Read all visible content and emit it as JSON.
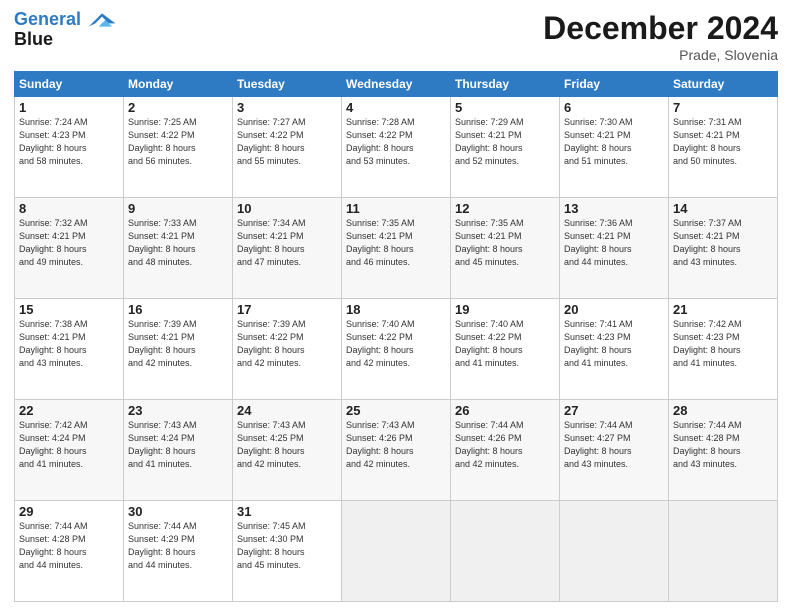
{
  "header": {
    "logo_line1": "General",
    "logo_line2": "Blue",
    "month": "December 2024",
    "location": "Prade, Slovenia"
  },
  "weekdays": [
    "Sunday",
    "Monday",
    "Tuesday",
    "Wednesday",
    "Thursday",
    "Friday",
    "Saturday"
  ],
  "weeks": [
    [
      {
        "day": "1",
        "info": "Sunrise: 7:24 AM\nSunset: 4:23 PM\nDaylight: 8 hours\nand 58 minutes."
      },
      {
        "day": "2",
        "info": "Sunrise: 7:25 AM\nSunset: 4:22 PM\nDaylight: 8 hours\nand 56 minutes."
      },
      {
        "day": "3",
        "info": "Sunrise: 7:27 AM\nSunset: 4:22 PM\nDaylight: 8 hours\nand 55 minutes."
      },
      {
        "day": "4",
        "info": "Sunrise: 7:28 AM\nSunset: 4:22 PM\nDaylight: 8 hours\nand 53 minutes."
      },
      {
        "day": "5",
        "info": "Sunrise: 7:29 AM\nSunset: 4:21 PM\nDaylight: 8 hours\nand 52 minutes."
      },
      {
        "day": "6",
        "info": "Sunrise: 7:30 AM\nSunset: 4:21 PM\nDaylight: 8 hours\nand 51 minutes."
      },
      {
        "day": "7",
        "info": "Sunrise: 7:31 AM\nSunset: 4:21 PM\nDaylight: 8 hours\nand 50 minutes."
      }
    ],
    [
      {
        "day": "8",
        "info": "Sunrise: 7:32 AM\nSunset: 4:21 PM\nDaylight: 8 hours\nand 49 minutes."
      },
      {
        "day": "9",
        "info": "Sunrise: 7:33 AM\nSunset: 4:21 PM\nDaylight: 8 hours\nand 48 minutes."
      },
      {
        "day": "10",
        "info": "Sunrise: 7:34 AM\nSunset: 4:21 PM\nDaylight: 8 hours\nand 47 minutes."
      },
      {
        "day": "11",
        "info": "Sunrise: 7:35 AM\nSunset: 4:21 PM\nDaylight: 8 hours\nand 46 minutes."
      },
      {
        "day": "12",
        "info": "Sunrise: 7:35 AM\nSunset: 4:21 PM\nDaylight: 8 hours\nand 45 minutes."
      },
      {
        "day": "13",
        "info": "Sunrise: 7:36 AM\nSunset: 4:21 PM\nDaylight: 8 hours\nand 44 minutes."
      },
      {
        "day": "14",
        "info": "Sunrise: 7:37 AM\nSunset: 4:21 PM\nDaylight: 8 hours\nand 43 minutes."
      }
    ],
    [
      {
        "day": "15",
        "info": "Sunrise: 7:38 AM\nSunset: 4:21 PM\nDaylight: 8 hours\nand 43 minutes."
      },
      {
        "day": "16",
        "info": "Sunrise: 7:39 AM\nSunset: 4:21 PM\nDaylight: 8 hours\nand 42 minutes."
      },
      {
        "day": "17",
        "info": "Sunrise: 7:39 AM\nSunset: 4:22 PM\nDaylight: 8 hours\nand 42 minutes."
      },
      {
        "day": "18",
        "info": "Sunrise: 7:40 AM\nSunset: 4:22 PM\nDaylight: 8 hours\nand 42 minutes."
      },
      {
        "day": "19",
        "info": "Sunrise: 7:40 AM\nSunset: 4:22 PM\nDaylight: 8 hours\nand 41 minutes."
      },
      {
        "day": "20",
        "info": "Sunrise: 7:41 AM\nSunset: 4:23 PM\nDaylight: 8 hours\nand 41 minutes."
      },
      {
        "day": "21",
        "info": "Sunrise: 7:42 AM\nSunset: 4:23 PM\nDaylight: 8 hours\nand 41 minutes."
      }
    ],
    [
      {
        "day": "22",
        "info": "Sunrise: 7:42 AM\nSunset: 4:24 PM\nDaylight: 8 hours\nand 41 minutes."
      },
      {
        "day": "23",
        "info": "Sunrise: 7:43 AM\nSunset: 4:24 PM\nDaylight: 8 hours\nand 41 minutes."
      },
      {
        "day": "24",
        "info": "Sunrise: 7:43 AM\nSunset: 4:25 PM\nDaylight: 8 hours\nand 42 minutes."
      },
      {
        "day": "25",
        "info": "Sunrise: 7:43 AM\nSunset: 4:26 PM\nDaylight: 8 hours\nand 42 minutes."
      },
      {
        "day": "26",
        "info": "Sunrise: 7:44 AM\nSunset: 4:26 PM\nDaylight: 8 hours\nand 42 minutes."
      },
      {
        "day": "27",
        "info": "Sunrise: 7:44 AM\nSunset: 4:27 PM\nDaylight: 8 hours\nand 43 minutes."
      },
      {
        "day": "28",
        "info": "Sunrise: 7:44 AM\nSunset: 4:28 PM\nDaylight: 8 hours\nand 43 minutes."
      }
    ],
    [
      {
        "day": "29",
        "info": "Sunrise: 7:44 AM\nSunset: 4:28 PM\nDaylight: 8 hours\nand 44 minutes."
      },
      {
        "day": "30",
        "info": "Sunrise: 7:44 AM\nSunset: 4:29 PM\nDaylight: 8 hours\nand 44 minutes."
      },
      {
        "day": "31",
        "info": "Sunrise: 7:45 AM\nSunset: 4:30 PM\nDaylight: 8 hours\nand 45 minutes."
      },
      null,
      null,
      null,
      null
    ]
  ]
}
